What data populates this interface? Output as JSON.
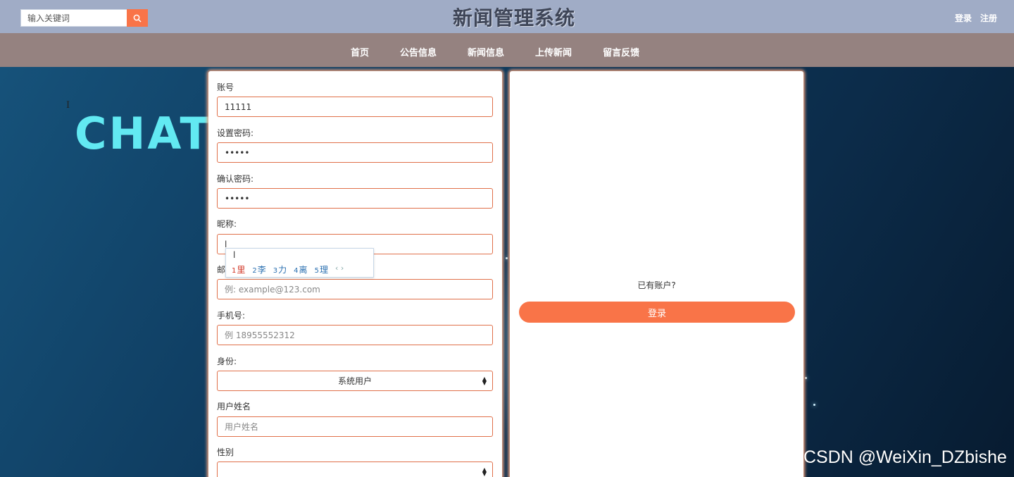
{
  "header": {
    "search_placeholder": "输入关键词",
    "site_title": "新闻管理系统",
    "login_link": "登录",
    "register_link": "注册"
  },
  "nav": {
    "items": [
      "首页",
      "公告信息",
      "新闻信息",
      "上传新闻",
      "留言反馈"
    ]
  },
  "hero": {
    "text": "CHAT"
  },
  "form": {
    "account_label": "账号",
    "account_value": "11111",
    "password_label": "设置密码:",
    "password_value": "•••••",
    "confirm_label": "确认密码:",
    "confirm_value": "•••••",
    "nickname_label": "昵称:",
    "nickname_value": "l",
    "email_label": "邮",
    "email_placeholder": "例: example@123.com",
    "phone_label": "手机号:",
    "phone_placeholder": "例  18955552312",
    "identity_label": "身份:",
    "identity_value": "系统用户",
    "realname_label": "用户姓名",
    "realname_placeholder": "用户姓名",
    "gender_label": "性别",
    "gender_value": ""
  },
  "ime": {
    "composition": "l",
    "candidates": [
      {
        "num": "1",
        "text": "里"
      },
      {
        "num": "2",
        "text": "李"
      },
      {
        "num": "3",
        "text": "力"
      },
      {
        "num": "4",
        "text": "离"
      },
      {
        "num": "5",
        "text": "理"
      }
    ],
    "pager": "‹ ›"
  },
  "side": {
    "have_account": "已有账户?",
    "login_button": "登录"
  },
  "watermark": "CSDN @WeiXin_DZbishe",
  "colors": {
    "accent": "#f97448",
    "topbar": "#a0acc6",
    "navbar": "#958280"
  }
}
